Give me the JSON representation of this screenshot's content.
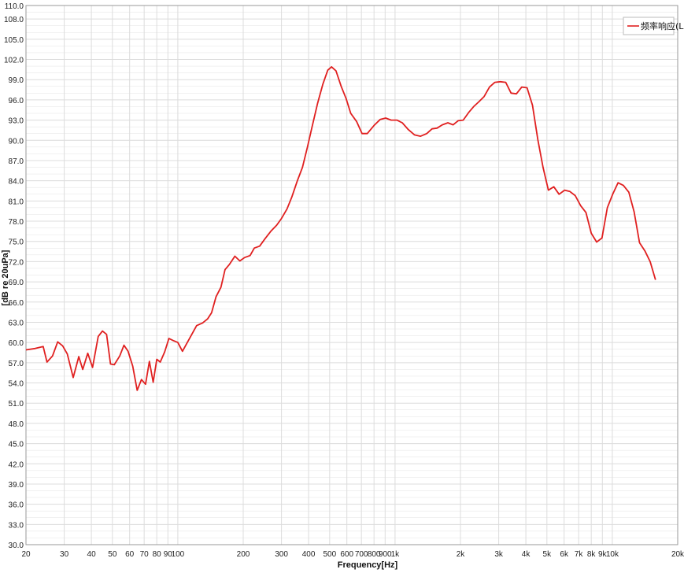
{
  "chart_data": {
    "type": "line",
    "title": "",
    "xlabel": "Frequency[Hz]",
    "ylabel": "[dB re 20uPa]",
    "x_scale": "log",
    "xlim": [
      20,
      20000
    ],
    "ylim": [
      30,
      110
    ],
    "grid": true,
    "legend_position": "top-right",
    "colors": {
      "series": "#e02020",
      "grid": "#dcdcdc",
      "axis": "#888888"
    },
    "y_ticks": [
      {
        "v": 30,
        "label": "30.0"
      },
      {
        "v": 33,
        "label": "33.0"
      },
      {
        "v": 36,
        "label": "36.0"
      },
      {
        "v": 39,
        "label": "39.0"
      },
      {
        "v": 42,
        "label": "42.0"
      },
      {
        "v": 45,
        "label": "45.0"
      },
      {
        "v": 48,
        "label": "48.0"
      },
      {
        "v": 51,
        "label": "51.0"
      },
      {
        "v": 54,
        "label": "54.0"
      },
      {
        "v": 57,
        "label": "57.0"
      },
      {
        "v": 60,
        "label": "60.0"
      },
      {
        "v": 63,
        "label": "63.0"
      },
      {
        "v": 66,
        "label": "66.0"
      },
      {
        "v": 69,
        "label": "69.0"
      },
      {
        "v": 72,
        "label": "72.0"
      },
      {
        "v": 75,
        "label": "75.0"
      },
      {
        "v": 78,
        "label": "78.0"
      },
      {
        "v": 81,
        "label": "81.0"
      },
      {
        "v": 84,
        "label": "84.0"
      },
      {
        "v": 87,
        "label": "87.0"
      },
      {
        "v": 90,
        "label": "90.0"
      },
      {
        "v": 93,
        "label": "93.0"
      },
      {
        "v": 96,
        "label": "96.0"
      },
      {
        "v": 99,
        "label": "99.0"
      },
      {
        "v": 102,
        "label": "102.0"
      },
      {
        "v": 105,
        "label": "105.0"
      },
      {
        "v": 108,
        "label": "108.0"
      },
      {
        "v": 110,
        "label": "110.0"
      }
    ],
    "x_ticks": [
      {
        "v": 20,
        "label": "20"
      },
      {
        "v": 30,
        "label": "30"
      },
      {
        "v": 40,
        "label": "40"
      },
      {
        "v": 50,
        "label": "50"
      },
      {
        "v": 60,
        "label": "60"
      },
      {
        "v": 70,
        "label": "70"
      },
      {
        "v": 80,
        "label": "80"
      },
      {
        "v": 90,
        "label": "90"
      },
      {
        "v": 100,
        "label": "100"
      },
      {
        "v": 200,
        "label": "200"
      },
      {
        "v": 300,
        "label": "300"
      },
      {
        "v": 400,
        "label": "400"
      },
      {
        "v": 500,
        "label": "500"
      },
      {
        "v": 600,
        "label": "600"
      },
      {
        "v": 700,
        "label": "700"
      },
      {
        "v": 800,
        "label": "800"
      },
      {
        "v": 900,
        "label": "900"
      },
      {
        "v": 1000,
        "label": "1k"
      },
      {
        "v": 2000,
        "label": "2k"
      },
      {
        "v": 3000,
        "label": "3k"
      },
      {
        "v": 4000,
        "label": "4k"
      },
      {
        "v": 5000,
        "label": "5k"
      },
      {
        "v": 6000,
        "label": "6k"
      },
      {
        "v": 7000,
        "label": "7k"
      },
      {
        "v": 8000,
        "label": "8k"
      },
      {
        "v": 9000,
        "label": "9k"
      },
      {
        "v": 10000,
        "label": "10k"
      },
      {
        "v": 20000,
        "label": "20k"
      }
    ],
    "series": [
      {
        "name": "频率响应(L)",
        "points": [
          [
            20,
            58.9
          ],
          [
            22,
            59.1
          ],
          [
            24,
            59.4
          ],
          [
            25,
            57.1
          ],
          [
            26.5,
            58.0
          ],
          [
            28,
            60.1
          ],
          [
            29.5,
            59.5
          ],
          [
            31,
            58.3
          ],
          [
            33,
            54.8
          ],
          [
            35,
            57.9
          ],
          [
            36.5,
            56.0
          ],
          [
            38.5,
            58.4
          ],
          [
            40.5,
            56.3
          ],
          [
            43,
            60.9
          ],
          [
            45,
            61.7
          ],
          [
            47,
            61.2
          ],
          [
            49,
            56.8
          ],
          [
            51,
            56.7
          ],
          [
            54,
            58.0
          ],
          [
            56.5,
            59.6
          ],
          [
            59,
            58.7
          ],
          [
            62,
            56.5
          ],
          [
            65,
            52.9
          ],
          [
            68,
            54.5
          ],
          [
            71,
            53.8
          ],
          [
            74,
            57.2
          ],
          [
            77,
            54.1
          ],
          [
            80,
            57.5
          ],
          [
            83,
            57.1
          ],
          [
            87,
            58.6
          ],
          [
            91,
            60.6
          ],
          [
            95,
            60.3
          ],
          [
            100,
            60.0
          ],
          [
            105,
            58.7
          ],
          [
            115,
            61.0
          ],
          [
            122,
            62.5
          ],
          [
            130,
            62.9
          ],
          [
            137,
            63.5
          ],
          [
            143,
            64.4
          ],
          [
            150,
            66.8
          ],
          [
            158,
            68.2
          ],
          [
            165,
            70.8
          ],
          [
            173,
            71.6
          ],
          [
            183,
            72.8
          ],
          [
            193,
            72.1
          ],
          [
            203,
            72.6
          ],
          [
            215,
            72.9
          ],
          [
            225,
            74.0
          ],
          [
            238,
            74.3
          ],
          [
            252,
            75.4
          ],
          [
            268,
            76.5
          ],
          [
            285,
            77.4
          ],
          [
            300,
            78.4
          ],
          [
            318,
            79.8
          ],
          [
            335,
            81.6
          ],
          [
            355,
            84.0
          ],
          [
            375,
            86.0
          ],
          [
            395,
            89.0
          ],
          [
            415,
            92.0
          ],
          [
            440,
            95.5
          ],
          [
            465,
            98.3
          ],
          [
            490,
            100.4
          ],
          [
            510,
            100.9
          ],
          [
            535,
            100.3
          ],
          [
            565,
            98.0
          ],
          [
            595,
            96.2
          ],
          [
            625,
            94.0
          ],
          [
            665,
            92.8
          ],
          [
            705,
            91.0
          ],
          [
            745,
            91.0
          ],
          [
            800,
            92.2
          ],
          [
            855,
            93.1
          ],
          [
            905,
            93.3
          ],
          [
            960,
            93.0
          ],
          [
            1020,
            93.0
          ],
          [
            1080,
            92.6
          ],
          [
            1150,
            91.6
          ],
          [
            1230,
            90.8
          ],
          [
            1310,
            90.6
          ],
          [
            1400,
            91.0
          ],
          [
            1480,
            91.7
          ],
          [
            1560,
            91.8
          ],
          [
            1650,
            92.3
          ],
          [
            1750,
            92.6
          ],
          [
            1850,
            92.3
          ],
          [
            1950,
            92.9
          ],
          [
            2060,
            93.0
          ],
          [
            2180,
            94.1
          ],
          [
            2300,
            95.0
          ],
          [
            2430,
            95.7
          ],
          [
            2570,
            96.5
          ],
          [
            2720,
            97.9
          ],
          [
            2880,
            98.6
          ],
          [
            3050,
            98.7
          ],
          [
            3230,
            98.6
          ],
          [
            3420,
            97.0
          ],
          [
            3620,
            96.9
          ],
          [
            3830,
            97.9
          ],
          [
            4050,
            97.8
          ],
          [
            4290,
            95.2
          ],
          [
            4540,
            90.1
          ],
          [
            4800,
            86.0
          ],
          [
            5080,
            82.6
          ],
          [
            5380,
            83.1
          ],
          [
            5690,
            82.0
          ],
          [
            6030,
            82.6
          ],
          [
            6380,
            82.4
          ],
          [
            6750,
            81.8
          ],
          [
            7150,
            80.3
          ],
          [
            7560,
            79.3
          ],
          [
            8000,
            76.2
          ],
          [
            8470,
            74.9
          ],
          [
            8960,
            75.5
          ],
          [
            9490,
            80.0
          ],
          [
            10040,
            82.0
          ],
          [
            10630,
            83.7
          ],
          [
            11250,
            83.3
          ],
          [
            11910,
            82.3
          ],
          [
            12600,
            79.4
          ],
          [
            13340,
            74.8
          ],
          [
            14120,
            73.6
          ],
          [
            14940,
            72.0
          ],
          [
            15810,
            69.3
          ]
        ]
      }
    ]
  }
}
